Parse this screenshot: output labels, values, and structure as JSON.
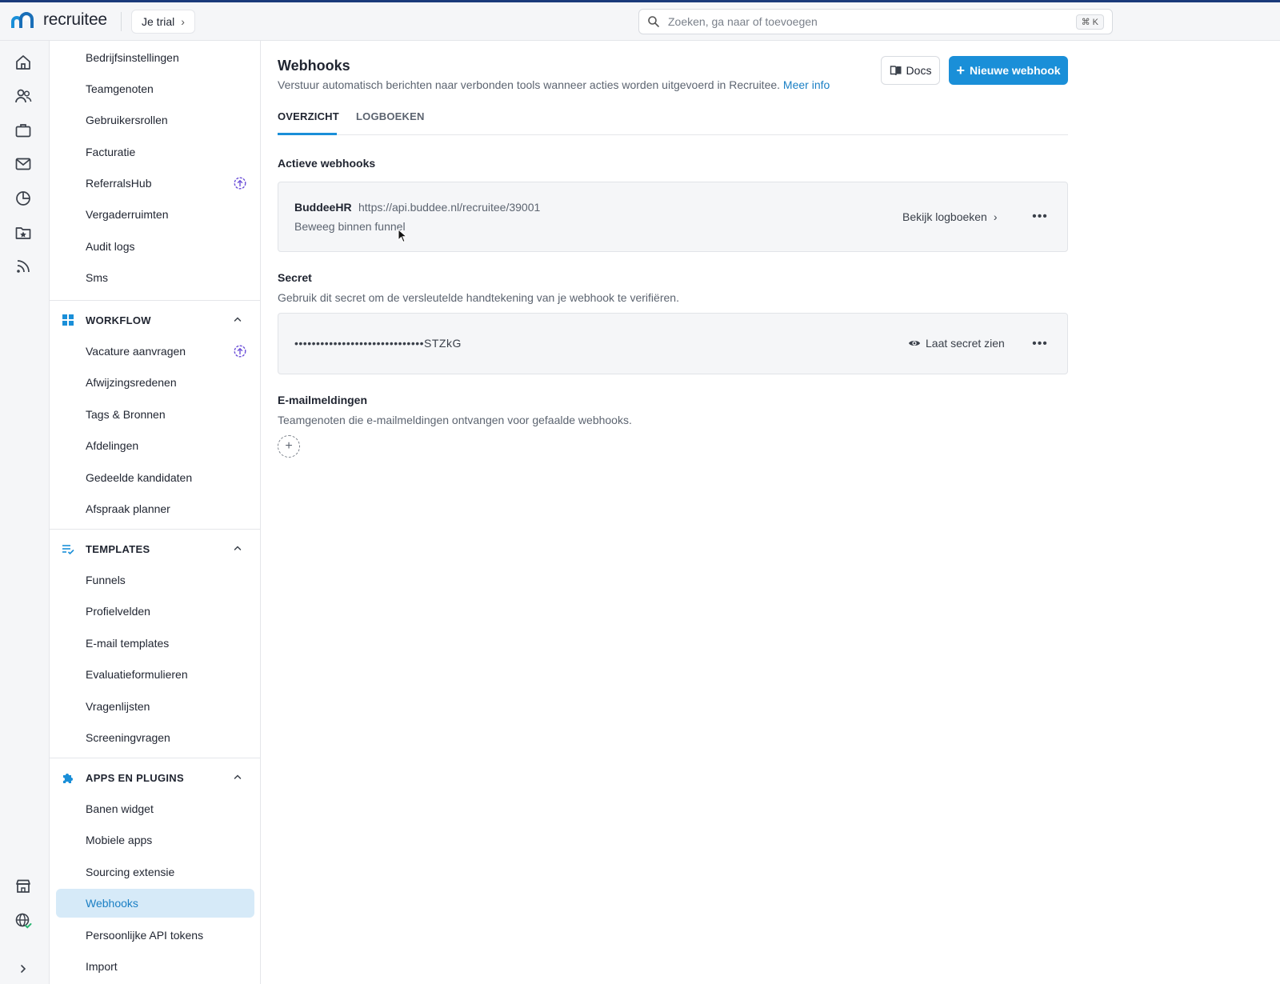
{
  "header": {
    "brand_name": "recruitee",
    "trial_label": "Je trial",
    "search_placeholder": "Zoeken, ga naar of toevoegen",
    "search_shortcut": "⌘ K"
  },
  "rail": {
    "icons": [
      "home-icon",
      "people-icon",
      "briefcase-icon",
      "mail-icon",
      "analytics-icon",
      "folder-star-icon",
      "feed-icon",
      "marketplace-icon",
      "globe-check-icon",
      "expand-icon"
    ]
  },
  "nav": {
    "top_items": [
      {
        "label": "Bedrijfsinstellingen"
      },
      {
        "label": "Teamgenoten"
      },
      {
        "label": "Gebruikersrollen"
      },
      {
        "label": "Facturatie"
      },
      {
        "label": "ReferralsHub",
        "badge": "upgrade-icon"
      },
      {
        "label": "Vergaderruimten"
      },
      {
        "label": "Audit logs"
      },
      {
        "label": "Sms"
      }
    ],
    "workflow": {
      "title": "WORKFLOW",
      "items": [
        {
          "label": "Vacature aanvragen",
          "badge": "upgrade-icon"
        },
        {
          "label": "Afwijzingsredenen"
        },
        {
          "label": "Tags & Bronnen"
        },
        {
          "label": "Afdelingen"
        },
        {
          "label": "Gedeelde kandidaten"
        },
        {
          "label": "Afspraak planner"
        }
      ]
    },
    "templates": {
      "title": "TEMPLATES",
      "items": [
        {
          "label": "Funnels"
        },
        {
          "label": "Profielvelden"
        },
        {
          "label": "E-mail templates"
        },
        {
          "label": "Evaluatieformulieren"
        },
        {
          "label": "Vragenlijsten"
        },
        {
          "label": "Screeningvragen"
        }
      ]
    },
    "apps": {
      "title": "APPS EN PLUGINS",
      "items": [
        {
          "label": "Banen widget"
        },
        {
          "label": "Mobiele apps"
        },
        {
          "label": "Sourcing extensie"
        },
        {
          "label": "Webhooks",
          "active": true
        },
        {
          "label": "Persoonlijke API tokens"
        },
        {
          "label": "Import"
        }
      ]
    }
  },
  "main": {
    "title": "Webhooks",
    "subtitle": "Verstuur automatisch berichten naar verbonden tools wanneer acties worden uitgevoerd in Recruitee.",
    "more_info": "Meer info",
    "docs_label": "Docs",
    "new_webhook_label": "Nieuwe webhook",
    "tabs": [
      {
        "label": "OVERZICHT",
        "active": true
      },
      {
        "label": "LOGBOEKEN",
        "active": false
      }
    ],
    "active_section": {
      "title": "Actieve webhooks",
      "webhook": {
        "name": "BuddeeHR",
        "url": "https://api.buddee.nl/recruitee/39001",
        "event": "Beweeg binnen funnel",
        "logs_label": "Bekijk logboeken"
      }
    },
    "secret_section": {
      "title": "Secret",
      "description": "Gebruik dit secret om de versleutelde handtekening van je webhook te verifiëren.",
      "masked_value": "••••••••••••••••••••••••••••••STZkG",
      "show_label": "Laat secret zien"
    },
    "email_section": {
      "title": "E-mailmeldingen",
      "description": "Teamgenoten die e-mailmeldingen ontvangen voor gefaalde webhooks."
    }
  },
  "colors": {
    "accent": "#1a8fd8",
    "active_nav_bg": "#d6eaf8",
    "upgrade_badge": "#6b4fd8"
  }
}
